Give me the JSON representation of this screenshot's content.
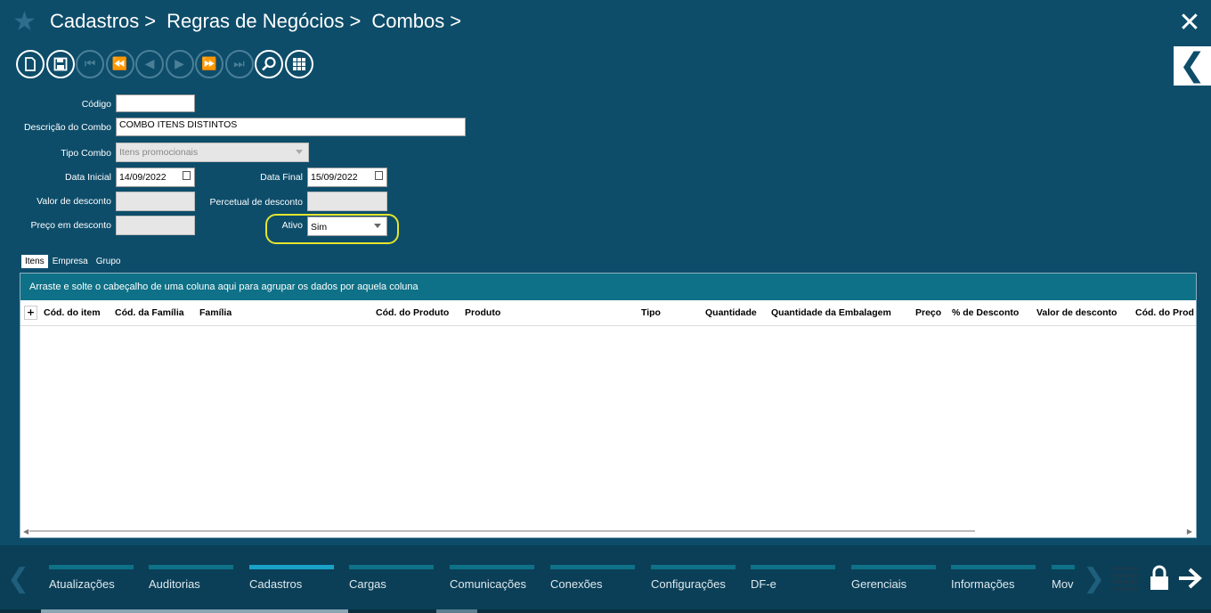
{
  "breadcrumbs": [
    "Cadastros",
    "Regras de Negócios",
    "Combos"
  ],
  "breadcrumb_sep": ">",
  "icons": {
    "favorite": "star-icon",
    "close": "close-icon",
    "back": "chevron-left-icon"
  },
  "form": {
    "codigo": {
      "label": "Código",
      "value": ""
    },
    "descricao": {
      "label": "Descrição do Combo",
      "value": "COMBO ITENS DISTINTOS"
    },
    "tipo_combo": {
      "label": "Tipo Combo",
      "placeholder": "Itens promocionais"
    },
    "data_inicial": {
      "label": "Data Inicial",
      "value": "14/09/2022"
    },
    "data_final": {
      "label": "Data Final",
      "value": "15/09/2022"
    },
    "valor_desconto": {
      "label": "Valor de desconto",
      "value": ""
    },
    "percentual_desconto": {
      "label": "Percetual de desconto",
      "value": ""
    },
    "preco_desconto": {
      "label": "Preço em desconto",
      "value": ""
    },
    "ativo": {
      "label": "Ativo",
      "value": "Sim"
    }
  },
  "tabs": [
    "Itens",
    "Empresa",
    "Grupo"
  ],
  "grid": {
    "group_hint": "Arraste e solte o cabeçalho de uma coluna aqui para agrupar os dados por aquela coluna",
    "expand": "+",
    "columns": [
      "Cód. do item",
      "Cód. da Família",
      "Família",
      "Cód. do Produto",
      "Produto",
      "Tipo",
      "Quantidade",
      "Quantidade da Embalagem",
      "Preço",
      "% de Desconto",
      "Valor de desconto",
      "Cód. do Prod"
    ]
  },
  "bottom_nav": {
    "items": [
      "Atualizações",
      "Auditorias",
      "Cadastros",
      "Cargas",
      "Comunicações",
      "Conexões",
      "Configurações",
      "DF-e",
      "Gerenciais",
      "Informações",
      "Mov"
    ],
    "active": "Cadastros"
  },
  "colors": {
    "background": "#0d4d6a",
    "group_bar": "#0e7187",
    "active_nav": "#1aa2c8",
    "highlight": "#e5e52d"
  }
}
